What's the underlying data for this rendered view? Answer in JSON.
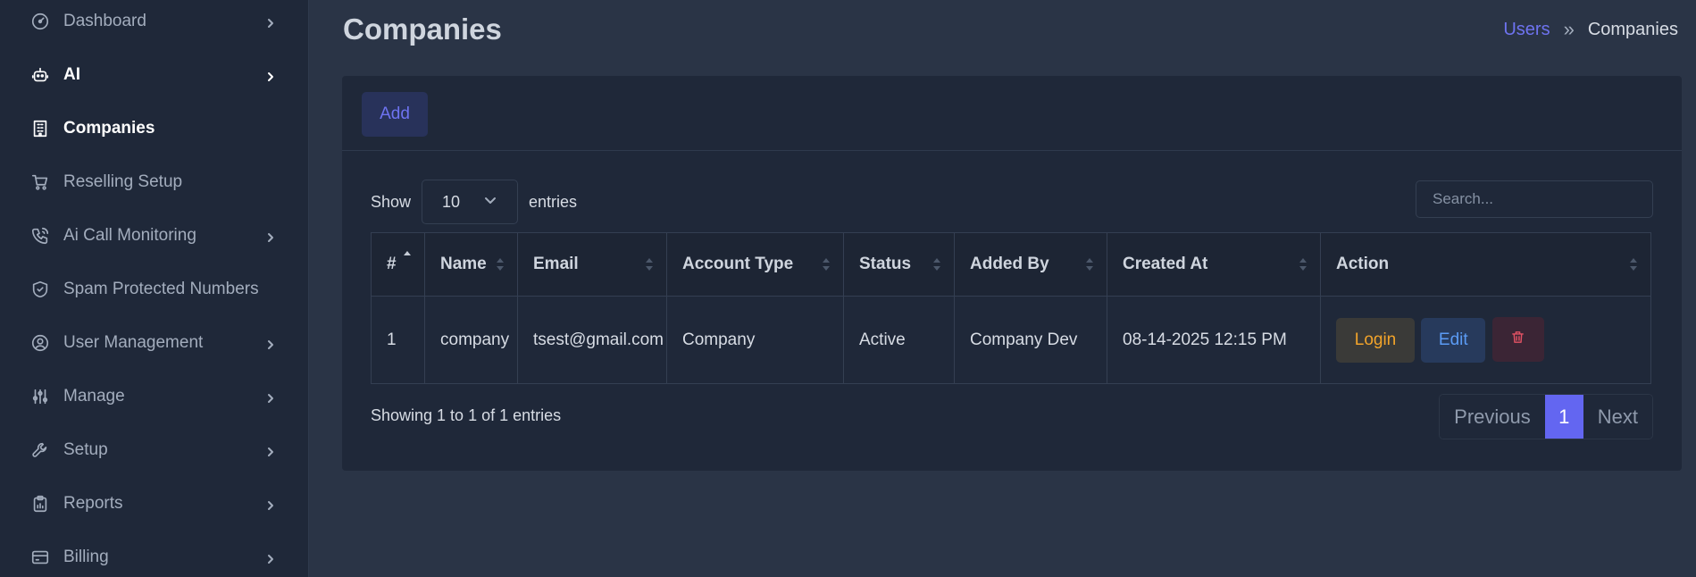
{
  "sidebar": {
    "items": [
      {
        "label": "Dashboard",
        "icon": "gauge-icon",
        "chevron": true
      },
      {
        "label": "AI",
        "icon": "robot-icon",
        "chevron": true
      },
      {
        "label": "Companies",
        "icon": "building-icon",
        "chevron": false,
        "active": true
      },
      {
        "label": "Reselling Setup",
        "icon": "cart-icon",
        "chevron": false
      },
      {
        "label": "Ai Call Monitoring",
        "icon": "phone-call-icon",
        "chevron": true
      },
      {
        "label": "Spam Protected Numbers",
        "icon": "shield-check-icon",
        "chevron": false
      },
      {
        "label": "User Management",
        "icon": "user-circle-icon",
        "chevron": true
      },
      {
        "label": "Manage",
        "icon": "sliders-icon",
        "chevron": true
      },
      {
        "label": "Setup",
        "icon": "wrench-icon",
        "chevron": true
      },
      {
        "label": "Reports",
        "icon": "clipboard-icon",
        "chevron": true
      },
      {
        "label": "Billing",
        "icon": "credit-card-icon",
        "chevron": true
      }
    ]
  },
  "header": {
    "title": "Companies",
    "breadcrumb": {
      "link": "Users",
      "separator": "»",
      "current": "Companies"
    }
  },
  "toolbar": {
    "add_label": "Add"
  },
  "table_controls": {
    "show_label": "Show",
    "page_size": "10",
    "entries_label": "entries",
    "search_placeholder": "Search..."
  },
  "table": {
    "columns": [
      "#",
      "Name",
      "Email",
      "Account Type",
      "Status",
      "Added By",
      "Created At",
      "Action"
    ],
    "rows": [
      {
        "index": "1",
        "name": "company",
        "email": "tsest@gmail.com",
        "account_type": "Company",
        "status": "Active",
        "added_by": "Company Dev",
        "created_at": "08-14-2025 12:15 PM"
      }
    ],
    "actions": {
      "login_label": "Login",
      "edit_label": "Edit",
      "delete_icon": "trash-icon"
    }
  },
  "footer": {
    "info": "Showing 1 to 1 of 1 entries",
    "pagination": {
      "previous": "Previous",
      "current_page": "1",
      "next": "Next"
    }
  },
  "colors": {
    "accent": "#6366f1",
    "login": "#f3a42a",
    "edit": "#5b9bf5",
    "delete": "#e35264"
  }
}
